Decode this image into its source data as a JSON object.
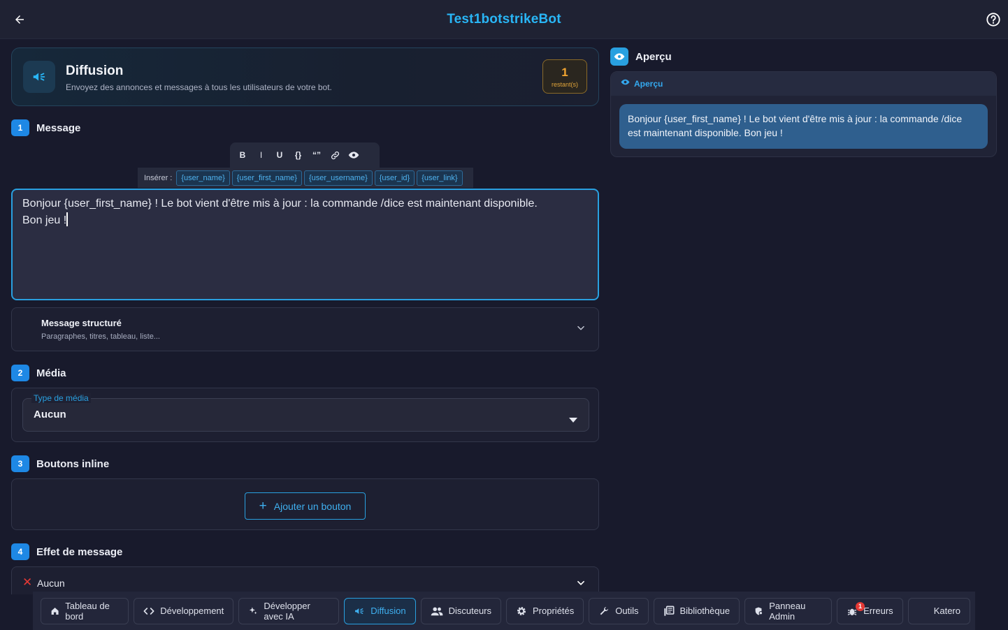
{
  "header": {
    "title": "Test1botstrikeBot"
  },
  "hero": {
    "title": "Diffusion",
    "subtitle": "Envoyez des annonces et messages à tous les utilisateurs de votre bot.",
    "quota_value": "1",
    "quota_label": "restant(s)"
  },
  "sections": {
    "message": {
      "number": "1",
      "title": "Message"
    },
    "media": {
      "number": "2",
      "title": "Média"
    },
    "buttons": {
      "number": "3",
      "title": "Boutons inline"
    },
    "effect": {
      "number": "4",
      "title": "Effet de message"
    }
  },
  "toolbar": {
    "bold": "B",
    "italic": "I",
    "underline": "U",
    "code": "{}",
    "quote": "“”"
  },
  "insert": {
    "label": "Insérer :",
    "chips": [
      "{user_name}",
      "{user_first_name}",
      "{user_username}",
      "{user_id}",
      "{user_link}"
    ]
  },
  "editor": {
    "line1": "Bonjour {user_first_name} ! Le bot vient d'être mis à jour : la commande /dice est maintenant disponible.",
    "line2": "Bon jeu !"
  },
  "structured": {
    "title": "Message structuré",
    "subtitle": "Paragraphes, titres, tableau, liste..."
  },
  "media": {
    "field_label": "Type de média",
    "value": "Aucun"
  },
  "buttons": {
    "add_label": "Ajouter un bouton"
  },
  "effect": {
    "value": "Aucun"
  },
  "preview": {
    "section_title": "Aperçu",
    "card_title": "Aperçu",
    "message_line1": "Bonjour {user_first_name} ! Le bot vient d'être mis à jour : la commande /dice",
    "message_line2": "est maintenant disponible. Bon jeu !"
  },
  "nav": {
    "items": [
      {
        "label": "Tableau de bord",
        "icon": "home-icon"
      },
      {
        "label": "Développement",
        "icon": "code-icon"
      },
      {
        "label": "Développer avec IA",
        "icon": "sparkle-icon"
      },
      {
        "label": "Diffusion",
        "icon": "megaphone-icon",
        "active": true
      },
      {
        "label": "Discuteurs",
        "icon": "users-icon"
      },
      {
        "label": "Propriétés",
        "icon": "gear-icon"
      },
      {
        "label": "Outils",
        "icon": "wrench-icon"
      },
      {
        "label": "Bibliothèque",
        "icon": "library-icon"
      },
      {
        "label": "Panneau Admin",
        "icon": "admin-shield-icon"
      },
      {
        "label": "Erreurs",
        "icon": "bug-icon",
        "badge": "1"
      },
      {
        "label": "Katero",
        "icon": ""
      }
    ]
  },
  "colors": {
    "accent": "#29a0e0",
    "warning": "#f2a531",
    "error": "#e53935"
  }
}
